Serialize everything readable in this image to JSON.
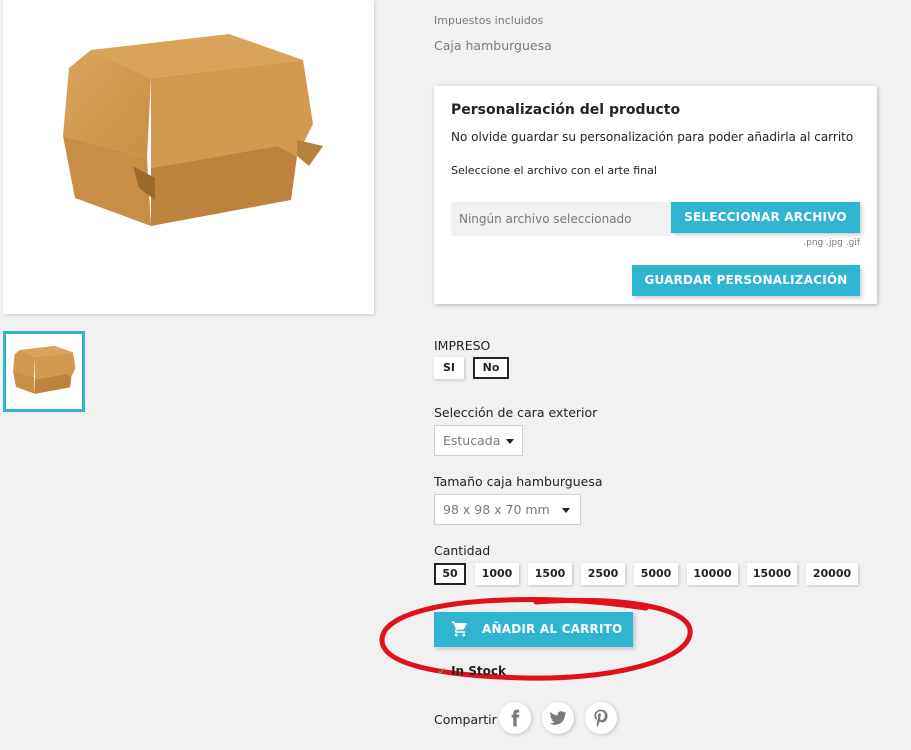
{
  "product": {
    "tax_note": "Impuestos incluidos",
    "subtitle": "Caja hamburguesa",
    "image_alt": "burger-box-image"
  },
  "customization": {
    "title": "Personalización del producto",
    "description": "No olvide guardar su personalización para poder añadirla al carrito",
    "file_label": "Seleccione el archivo con el arte final",
    "file_placeholder": "Ningún archivo seleccionado",
    "select_button": "SELECCIONAR ARCHIVO",
    "allowed_extensions": ".png .jpg .gif",
    "save_button": "GUARDAR PERSONALIZACIÓN"
  },
  "impreso": {
    "label": "IMPRESO",
    "options": [
      "SI",
      "No"
    ],
    "selected": "No"
  },
  "cara_exterior": {
    "label": "Selección de cara exterior",
    "selected": "Estucada"
  },
  "tamano": {
    "label": "Tamaño caja hamburguesa",
    "selected": "98 x 98 x 70 mm"
  },
  "cantidad": {
    "label": "Cantidad",
    "options": [
      "50",
      "1000",
      "1500",
      "2500",
      "5000",
      "10000",
      "15000",
      "20000"
    ],
    "selected": "50"
  },
  "cart": {
    "add_button": "AÑADIR AL CARRITO"
  },
  "stock": {
    "status": "In Stock"
  },
  "share": {
    "label": "Compartir",
    "networks": [
      "facebook-icon",
      "twitter-icon",
      "pinterest-icon"
    ]
  },
  "colors": {
    "accent": "#2fb5d2",
    "background": "#f1f1f1",
    "annotation": "#e0111b",
    "in_stock": "#4cbb6c"
  }
}
